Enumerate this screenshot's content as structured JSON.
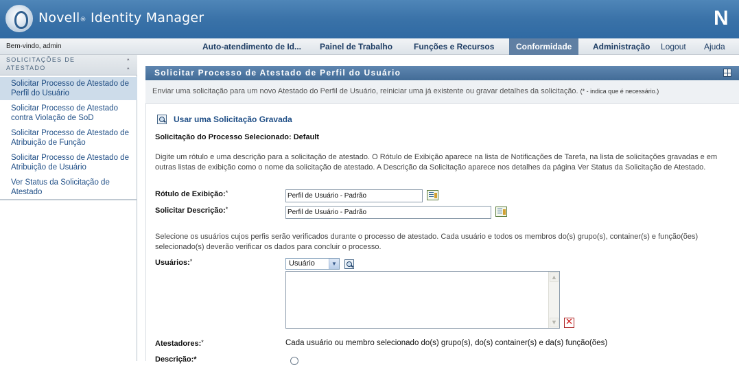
{
  "header": {
    "brand": "Novell",
    "reg_mark": "®",
    "product": " Identity Manager",
    "corner_logo": "N"
  },
  "topnav": {
    "welcome": "Bem-vindo, admin",
    "items": [
      {
        "label": "Auto-atendimento de Id..."
      },
      {
        "label": "Painel de Trabalho"
      },
      {
        "label": "Funções e Recursos"
      },
      {
        "label": "Conformidade",
        "active": true
      },
      {
        "label": "Administração"
      },
      {
        "label": "Logout"
      },
      {
        "label": "Ajuda"
      }
    ]
  },
  "sidebar": {
    "heading": "SOLICITAÇÕES DE ATESTADO",
    "items": [
      {
        "label": "Solicitar Processo de Atestado de Perfil do Usuário",
        "selected": true
      },
      {
        "label": "Solicitar Processo de Atestado contra Violação de SoD"
      },
      {
        "label": "Solicitar Processo de Atestado de Atribuição de Função"
      },
      {
        "label": "Solicitar Processo de Atestado de Atribuição de Usuário"
      },
      {
        "label": "Ver Status da Solicitação de Atestado"
      }
    ]
  },
  "panel": {
    "title": "Solicitar Processo de Atestado de Perfil do Usuário",
    "description": "Enviar uma solicitação para um novo Atestado do Perfil de Usuário, reiniciar uma já existente ou gravar detalhes da solicitação.",
    "required_note": "(* - indica que é necessário.)"
  },
  "form": {
    "saved_request_link": "Usar uma Solicitação Gravada",
    "selected_process_label": "Solicitação do Processo Selecionado: Default",
    "intro_text": "Digite um rótulo e uma descrição para a solicitação de atestado. O Rótulo de Exibição aparece na lista de Notificações de Tarefa, na lista de solicitações gravadas e em outras listas de exibição como o nome da solicitação de atestado. A Descrição da Solicitação aparece nos detalhes da página Ver Status da Solicitação de Atestado.",
    "display_label": {
      "label": "Rótulo de Exibição:",
      "required_mark": "*",
      "value": "Perfil de Usuário - Padrão"
    },
    "request_description": {
      "label": "Solicitar Descrição:",
      "required_mark": "*",
      "value": "Perfil de Usuário - Padrão"
    },
    "users_intro": "Selecione os usuários cujos perfis serão verificados durante o processo de atestado. Cada usuário e todos os membros do(s) grupo(s), container(s) e função(ões) selecionado(s) deverão verificar os dados para concluir o processo.",
    "users": {
      "label": "Usuários:",
      "required_mark": "*",
      "type_selected": "Usuário"
    },
    "attesters": {
      "label": "Atestadores:",
      "required_mark": "*",
      "value": "Cada usuário ou membro selecionado do(s) grupo(s), do(s) container(s) e da(s) função(ões)"
    },
    "next_label_partial": "Descrição:*"
  }
}
